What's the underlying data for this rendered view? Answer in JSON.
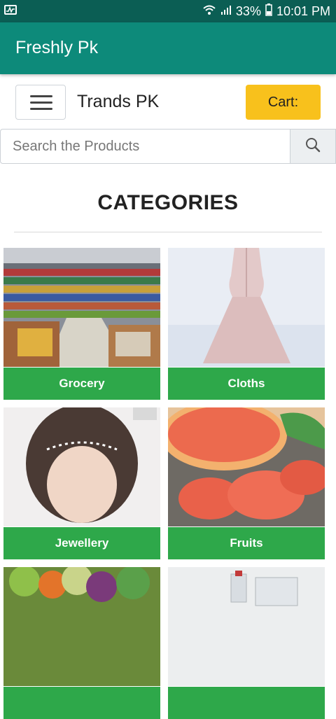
{
  "status_bar": {
    "battery": "33%",
    "time": "10:01 PM"
  },
  "app_bar": {
    "title": "Freshly Pk"
  },
  "header": {
    "brand": "Trands PK",
    "cart_label": "Cart:"
  },
  "search": {
    "placeholder": "Search the Products"
  },
  "categories": {
    "title": "CATEGORIES",
    "items": [
      {
        "label": "Grocery"
      },
      {
        "label": "Cloths"
      },
      {
        "label": "Jewellery"
      },
      {
        "label": "Fruits"
      },
      {
        "label": ""
      },
      {
        "label": ""
      }
    ]
  },
  "colors": {
    "status_bar": "#0b5e54",
    "app_bar": "#0d8a7a",
    "cart_button": "#f8c11c",
    "category_label": "#2ea84a"
  }
}
